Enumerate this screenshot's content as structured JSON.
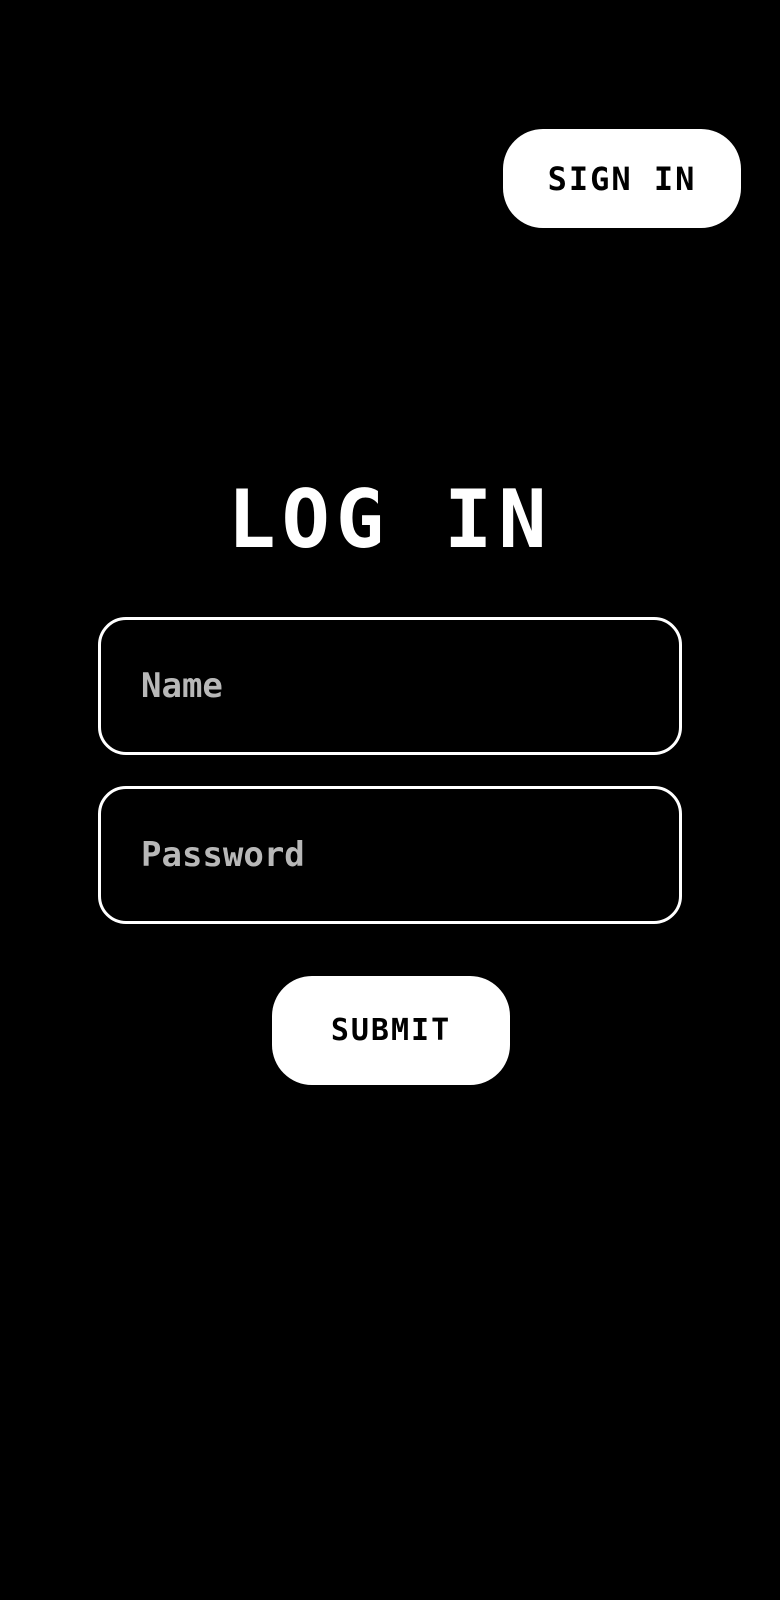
{
  "header": {
    "sign_in_label": "SIGN IN"
  },
  "form": {
    "title": "LOG IN",
    "name_placeholder": "Name",
    "password_placeholder": "Password",
    "submit_label": "SUBMIT"
  },
  "colors": {
    "background": "#000000",
    "foreground": "#ffffff",
    "placeholder": "#b8b8b8"
  }
}
